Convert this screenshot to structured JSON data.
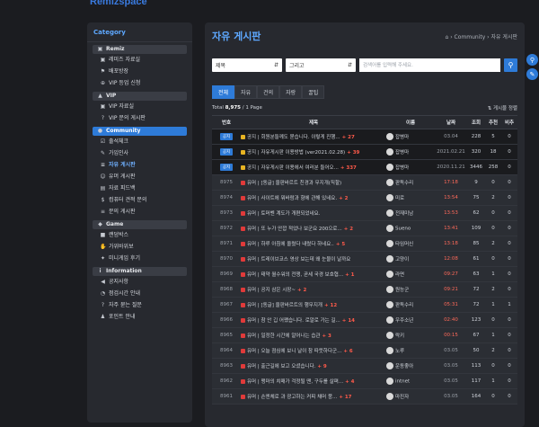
{
  "brand": "Remizspace",
  "sidebar": {
    "title": "Category",
    "sections": [
      {
        "label": "Remiz",
        "icon": "book-icon",
        "items": [
          {
            "label": "레미즈 자료실",
            "icon": "book-icon"
          },
          {
            "label": "배포방장",
            "icon": "flag-icon"
          },
          {
            "label": "VIP 등업 신청",
            "icon": "plus-icon"
          }
        ]
      },
      {
        "label": "VIP",
        "icon": "lock-icon",
        "items": [
          {
            "label": "VIP 자료실",
            "icon": "book-icon"
          },
          {
            "label": "VIP 문의 게시판",
            "icon": "question-icon"
          }
        ]
      },
      {
        "label": "Community",
        "icon": "chat-icon",
        "active": true,
        "items": [
          {
            "label": "출석체크",
            "icon": "check-icon"
          },
          {
            "label": "가입인사",
            "icon": "pen-icon"
          },
          {
            "label": "자유 게시판",
            "icon": "list-icon",
            "current": true
          },
          {
            "label": "유머 게시판",
            "icon": "smile-icon"
          },
          {
            "label": "자료 피드백",
            "icon": "folder-icon"
          },
          {
            "label": "컴퓨터 견적 문의",
            "icon": "dollar-icon"
          },
          {
            "label": "문의 게시판",
            "icon": "list-icon"
          }
        ]
      },
      {
        "label": "Game",
        "icon": "gamepad-icon",
        "items": [
          {
            "label": "랜덤박스",
            "icon": "box-icon"
          },
          {
            "label": "가위바위보",
            "icon": "hand-icon"
          },
          {
            "label": "미니게임 후기",
            "icon": "sparkle-icon"
          }
        ]
      },
      {
        "label": "Information",
        "icon": "info-icon",
        "items": [
          {
            "label": "공지사항",
            "icon": "megaphone-icon"
          },
          {
            "label": "점검시간 안내",
            "icon": "clock-icon"
          },
          {
            "label": "자주 묻는 질문",
            "icon": "question-icon"
          },
          {
            "label": "포인트 안내",
            "icon": "person-icon"
          }
        ]
      }
    ]
  },
  "page": {
    "title": "자유 게시판",
    "breadcrumb": [
      "Community",
      "자유 게시판"
    ],
    "search": {
      "field": "제목",
      "op": "그리고",
      "placeholder": "검색어를 입력해 주세요."
    },
    "tabs": [
      "전체",
      "자유",
      "건의",
      "자랑",
      "꿀팁"
    ],
    "active_tab": "전체",
    "total_label": "Total",
    "total_count": "8,975",
    "page_label": "/ 1 Page",
    "sort_label": "게시물 정렬",
    "columns": [
      "번호",
      "제목",
      "이름",
      "날짜",
      "조회",
      "추천",
      "비추"
    ],
    "notice_badge": "공지",
    "notices": [
      {
        "title": "공지 | 회원분들께도 묻습니다. 이렇게 진행...",
        "comments": "+ 27",
        "name": "잡병마",
        "date": "03.04",
        "views": "228",
        "up": "5",
        "down": "0"
      },
      {
        "title": "공지 | 자유게시판 이용방법 (ver2021.02.28)",
        "comments": "+ 39",
        "name": "잡병마",
        "date": "2021.02.21",
        "views": "320",
        "up": "18",
        "down": "0"
      },
      {
        "title": "공지 | 자유게시판 이용에서 여러분 들어오...",
        "comments": "+ 337",
        "name": "잡병마",
        "date": "2020.11.21",
        "views": "3446",
        "up": "258",
        "down": "0"
      }
    ],
    "rows": [
      {
        "no": "8975",
        "title": "유머 | [동글] 울판바르트 친경과 무지개(직할)",
        "comments": "",
        "name": "판독수리",
        "date": "17:18",
        "views": "9",
        "up": "0",
        "down": "0",
        "red": true
      },
      {
        "no": "8974",
        "title": "유머 | 사이트에 뭐바람과 향에 관해 있네요.",
        "comments": "+ 2",
        "name": "미로",
        "date": "13:54",
        "views": "75",
        "up": "2",
        "down": "0",
        "red": true
      },
      {
        "no": "8973",
        "title": "유머 | 토머벤 계도가 개편되었네요.",
        "comments": "",
        "name": "전재미남",
        "date": "13:53",
        "views": "62",
        "up": "0",
        "down": "0",
        "red": true
      },
      {
        "no": "8972",
        "title": "유머 | 또 누가 안깝 적었나 보군요 200으로...",
        "comments": "+ 2",
        "name": "Sueno",
        "date": "13:41",
        "views": "109",
        "up": "0",
        "down": "0",
        "red": true
      },
      {
        "no": "8971",
        "title": "유머 | 하루 아침에 올렸다 내렸다 하네요..",
        "comments": "+ 5",
        "name": "타임머신",
        "date": "13:18",
        "views": "85",
        "up": "2",
        "down": "0",
        "red": true
      },
      {
        "no": "8970",
        "title": "유머 | 트레이브코스 영상 보는데 왜 눈물이 날까요",
        "comments": "",
        "name": "고양이",
        "date": "12:08",
        "views": "61",
        "up": "0",
        "down": "0",
        "red": true
      },
      {
        "no": "8969",
        "title": "유머 | 태약 월수워의 전쟁, 곧세 국경 보호협...",
        "comments": "+ 1",
        "name": "라면",
        "date": "09:27",
        "views": "63",
        "up": "1",
        "down": "0",
        "red": true
      },
      {
        "no": "8968",
        "title": "유머 | 공지 삼은 시장~",
        "comments": "+ 2",
        "name": "원능군",
        "date": "09:21",
        "views": "72",
        "up": "2",
        "down": "0",
        "red": true
      },
      {
        "no": "8967",
        "title": "유머 | [동글] 울판바르트의 행무지개",
        "comments": "+ 12",
        "name": "판독수리",
        "date": "05:31",
        "views": "72",
        "up": "1",
        "down": "1",
        "red": true
      },
      {
        "no": "8966",
        "title": "유머 | 참 안 깁 어쨌습니다. 로알로 가는 길...",
        "comments": "+ 14",
        "name": "우주소년",
        "date": "02:40",
        "views": "123",
        "up": "0",
        "down": "0",
        "red": true
      },
      {
        "no": "8965",
        "title": "유머 | 일정한 시간에 알어나는 습관",
        "comments": "+ 3",
        "name": "락키",
        "date": "00:15",
        "views": "67",
        "up": "1",
        "down": "0",
        "red": true
      },
      {
        "no": "8964",
        "title": "유머 | 오늘 점심에 보니 날이 참 따뜻하다군...",
        "comments": "+ 6",
        "name": "노루",
        "date": "03.05",
        "views": "50",
        "up": "2",
        "down": "0",
        "red": false
      },
      {
        "no": "8963",
        "title": "유머 | 출근길에 보고 오셨습니다.",
        "comments": "+ 9",
        "name": "운동좋아",
        "date": "03.05",
        "views": "113",
        "up": "0",
        "down": "0",
        "red": false
      },
      {
        "no": "8962",
        "title": "유머 | 맹마의 치매가 걱정될 땐, 구두를 살펴...",
        "comments": "+ 4",
        "name": "intnet",
        "date": "03.05",
        "views": "117",
        "up": "1",
        "down": "0",
        "red": false
      },
      {
        "no": "8961",
        "title": "유머 | 손엔체로 과 광고하는 커피 채머 뭉...",
        "comments": "+ 17",
        "name": "마진자",
        "date": "03.05",
        "views": "164",
        "up": "0",
        "down": "0",
        "red": false
      }
    ]
  },
  "colors": {
    "accent": "#2e7bd8",
    "title": "#5ea8ff",
    "red": "#ff6a5a"
  }
}
